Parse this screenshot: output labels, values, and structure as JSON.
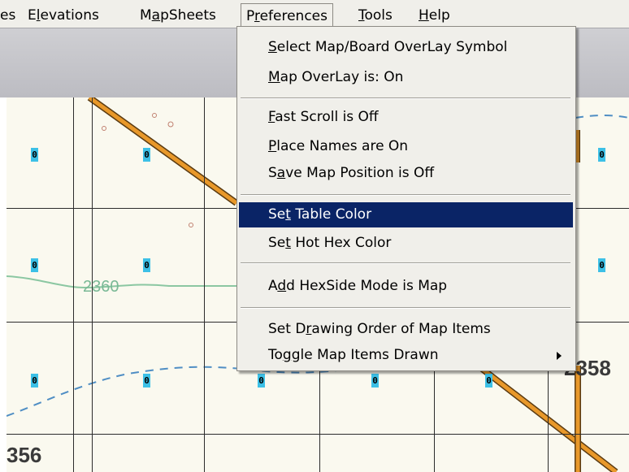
{
  "menubar": {
    "items": [
      {
        "label": "es",
        "mnemonic": ""
      },
      {
        "label": "Elevations",
        "mnemonic": "l"
      },
      {
        "label": "MapSheets",
        "mnemonic": "a"
      },
      {
        "label": "Preferences",
        "mnemonic": "r"
      },
      {
        "label": "Tools",
        "mnemonic": "T"
      },
      {
        "label": "Help",
        "mnemonic": "H"
      }
    ]
  },
  "preferences_menu": {
    "items": [
      {
        "label": "Select Map/Board OverLay Symbol",
        "mnemonic": "S",
        "selected": false
      },
      {
        "label": "Map OverLay is: On",
        "mnemonic": "M",
        "selected": false
      },
      {
        "label": "Fast Scroll is Off",
        "mnemonic": "F",
        "selected": false
      },
      {
        "label": "Place Names are On",
        "mnemonic": "P",
        "selected": false
      },
      {
        "label": "Save Map Position is Off",
        "mnemonic": "a",
        "selected": false
      },
      {
        "label": "Set Table Color",
        "mnemonic": "t",
        "selected": true
      },
      {
        "label": "Set Hot Hex Color",
        "mnemonic": "t",
        "selected": false
      },
      {
        "label": "Add HexSide Mode is Map",
        "mnemonic": "d",
        "selected": false
      },
      {
        "label": "Set Drawing Order of Map Items",
        "mnemonic": "r",
        "selected": false
      },
      {
        "label": "Toggle Map Items Drawn",
        "mnemonic": "g",
        "selected": false,
        "submenu": true
      }
    ]
  },
  "map": {
    "hex_label": "0",
    "contour_labels": [
      "2360",
      "2358",
      "356"
    ]
  },
  "colors": {
    "menu_bg": "#f0efea",
    "selection": "#0a2466",
    "map_bg": "#faf9ef",
    "road": "#e8982a",
    "hex_marker": "#3cc0e6",
    "contour": "#8bc7a2",
    "stream": "#4f8ec4"
  }
}
